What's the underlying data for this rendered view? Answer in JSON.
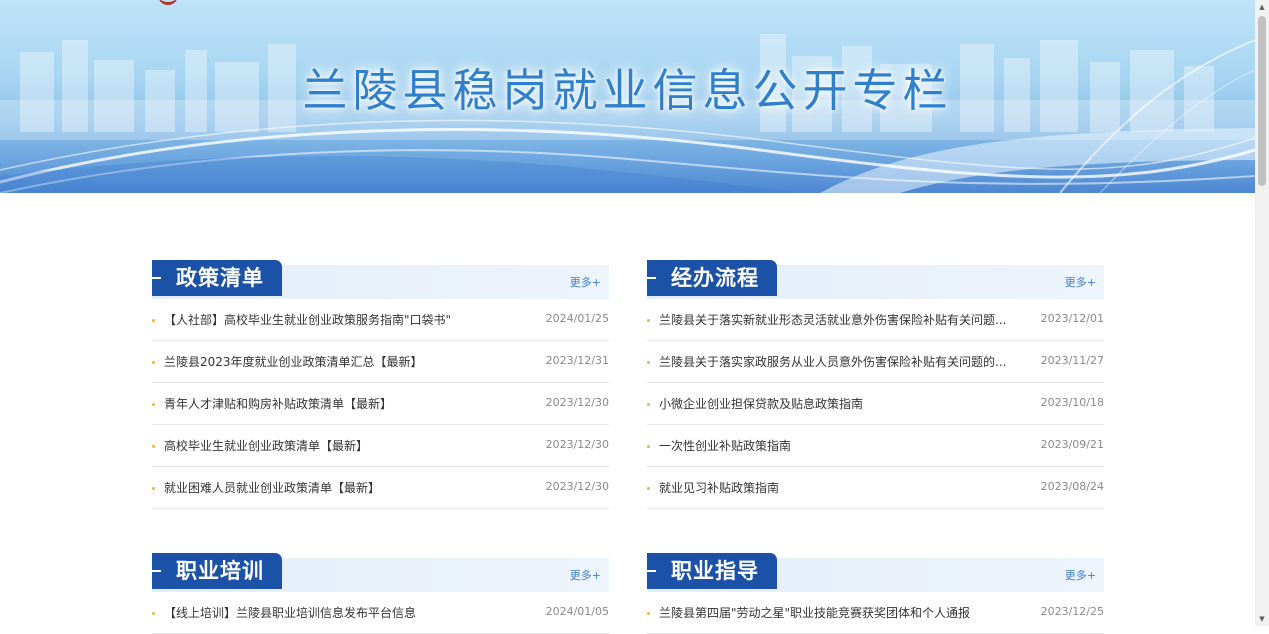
{
  "banner": {
    "title": "兰陵县稳岗就业信息公开专栏"
  },
  "theme": {
    "tab_color": "#1b52a8",
    "bullet_color": "#efb347",
    "more_color": "#3f7fd1"
  },
  "panels": [
    {
      "title": "政策清单",
      "more": "更多+",
      "items": [
        {
          "title": "【人社部】高校毕业生就业创业政策服务指南\"口袋书\"",
          "date": "2024/01/25"
        },
        {
          "title": "兰陵县2023年度就业创业政策清单汇总【最新】",
          "date": "2023/12/31"
        },
        {
          "title": "青年人才津贴和购房补贴政策清单【最新】",
          "date": "2023/12/30"
        },
        {
          "title": "高校毕业生就业创业政策清单【最新】",
          "date": "2023/12/30"
        },
        {
          "title": "就业困难人员就业创业政策清单【最新】",
          "date": "2023/12/30"
        }
      ]
    },
    {
      "title": "经办流程",
      "more": "更多+",
      "items": [
        {
          "title": "兰陵县关于落实新就业形态灵活就业意外伤害保险补贴有关问题...",
          "date": "2023/12/01"
        },
        {
          "title": "兰陵县关于落实家政服务从业人员意外伤害保险补贴有关问题的...",
          "date": "2023/11/27"
        },
        {
          "title": "小微企业创业担保贷款及贴息政策指南",
          "date": "2023/10/18"
        },
        {
          "title": "一次性创业补贴政策指南",
          "date": "2023/09/21"
        },
        {
          "title": "就业见习补贴政策指南",
          "date": "2023/08/24"
        }
      ]
    },
    {
      "title": "职业培训",
      "more": "更多+",
      "items": [
        {
          "title": "【线上培训】兰陵县职业培训信息发布平台信息",
          "date": "2024/01/05"
        }
      ]
    },
    {
      "title": "职业指导",
      "more": "更多+",
      "items": [
        {
          "title": "兰陵县第四届\"劳动之星\"职业技能竞赛获奖团体和个人通报",
          "date": "2023/12/25"
        }
      ]
    }
  ]
}
